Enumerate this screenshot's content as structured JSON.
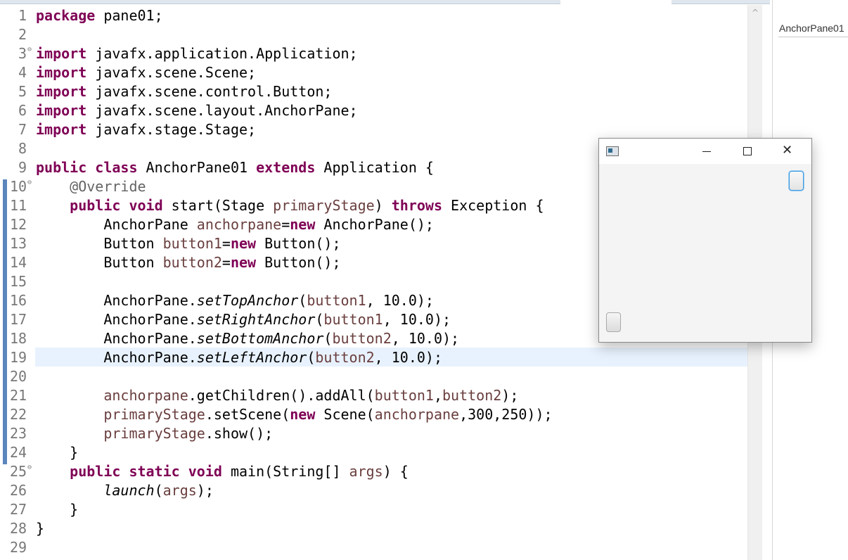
{
  "editor": {
    "lines": [
      {
        "num": "1",
        "fold": false,
        "segments": [
          {
            "t": "package",
            "c": "kw"
          },
          {
            "t": " pane01;"
          }
        ]
      },
      {
        "num": "2",
        "fold": false,
        "segments": []
      },
      {
        "num": "3",
        "fold": true,
        "segments": [
          {
            "t": "import",
            "c": "kw"
          },
          {
            "t": " javafx.application.Application;"
          }
        ]
      },
      {
        "num": "4",
        "fold": false,
        "segments": [
          {
            "t": "import",
            "c": "kw"
          },
          {
            "t": " javafx.scene.Scene;"
          }
        ]
      },
      {
        "num": "5",
        "fold": false,
        "segments": [
          {
            "t": "import",
            "c": "kw"
          },
          {
            "t": " javafx.scene.control.Button;"
          }
        ]
      },
      {
        "num": "6",
        "fold": false,
        "segments": [
          {
            "t": "import",
            "c": "kw"
          },
          {
            "t": " javafx.scene.layout.AnchorPane;"
          }
        ]
      },
      {
        "num": "7",
        "fold": false,
        "segments": [
          {
            "t": "import",
            "c": "kw"
          },
          {
            "t": " javafx.stage.Stage;"
          }
        ]
      },
      {
        "num": "8",
        "fold": false,
        "segments": []
      },
      {
        "num": "9",
        "fold": false,
        "segments": [
          {
            "t": "public class",
            "c": "kw"
          },
          {
            "t": " AnchorPane01 "
          },
          {
            "t": "extends",
            "c": "kw"
          },
          {
            "t": " Application {"
          }
        ]
      },
      {
        "num": "10",
        "fold": true,
        "segments": [
          {
            "t": "    "
          },
          {
            "t": "@Override",
            "c": "ann"
          }
        ]
      },
      {
        "num": "11",
        "fold": false,
        "segments": [
          {
            "t": "    "
          },
          {
            "t": "public void",
            "c": "kw"
          },
          {
            "t": " start(Stage "
          },
          {
            "t": "primaryStage",
            "c": "var"
          },
          {
            "t": ") "
          },
          {
            "t": "throws",
            "c": "kw"
          },
          {
            "t": " Exception {"
          }
        ]
      },
      {
        "num": "12",
        "fold": false,
        "segments": [
          {
            "t": "        AnchorPane "
          },
          {
            "t": "anchorpane",
            "c": "var"
          },
          {
            "t": "="
          },
          {
            "t": "new",
            "c": "kw"
          },
          {
            "t": " AnchorPane();"
          }
        ]
      },
      {
        "num": "13",
        "fold": false,
        "segments": [
          {
            "t": "        Button "
          },
          {
            "t": "button1",
            "c": "var"
          },
          {
            "t": "="
          },
          {
            "t": "new",
            "c": "kw"
          },
          {
            "t": " Button();"
          }
        ]
      },
      {
        "num": "14",
        "fold": false,
        "segments": [
          {
            "t": "        Button "
          },
          {
            "t": "button2",
            "c": "var"
          },
          {
            "t": "="
          },
          {
            "t": "new",
            "c": "kw"
          },
          {
            "t": " Button();"
          }
        ]
      },
      {
        "num": "15",
        "fold": false,
        "segments": []
      },
      {
        "num": "16",
        "fold": false,
        "segments": [
          {
            "t": "        AnchorPane."
          },
          {
            "t": "setTopAnchor",
            "c": "ita"
          },
          {
            "t": "("
          },
          {
            "t": "button1",
            "c": "var"
          },
          {
            "t": ", 10.0);"
          }
        ]
      },
      {
        "num": "17",
        "fold": false,
        "segments": [
          {
            "t": "        AnchorPane."
          },
          {
            "t": "setRightAnchor",
            "c": "ita"
          },
          {
            "t": "("
          },
          {
            "t": "button1",
            "c": "var"
          },
          {
            "t": ", 10.0);"
          }
        ]
      },
      {
        "num": "18",
        "fold": false,
        "segments": [
          {
            "t": "        AnchorPane."
          },
          {
            "t": "setBottomAnchor",
            "c": "ita"
          },
          {
            "t": "("
          },
          {
            "t": "button2",
            "c": "var"
          },
          {
            "t": ", 10.0);"
          }
        ]
      },
      {
        "num": "19",
        "fold": false,
        "current": true,
        "segments": [
          {
            "t": "        AnchorPane."
          },
          {
            "t": "setLeftAnchor",
            "c": "ita"
          },
          {
            "t": "("
          },
          {
            "t": "button2",
            "c": "var"
          },
          {
            "t": ", 10.0);"
          }
        ]
      },
      {
        "num": "20",
        "fold": false,
        "segments": []
      },
      {
        "num": "21",
        "fold": false,
        "segments": [
          {
            "t": "        "
          },
          {
            "t": "anchorpane",
            "c": "var"
          },
          {
            "t": ".getChildren().addAll("
          },
          {
            "t": "button1",
            "c": "var"
          },
          {
            "t": ","
          },
          {
            "t": "button2",
            "c": "var"
          },
          {
            "t": ");"
          }
        ]
      },
      {
        "num": "22",
        "fold": false,
        "segments": [
          {
            "t": "        "
          },
          {
            "t": "primaryStage",
            "c": "var"
          },
          {
            "t": ".setScene("
          },
          {
            "t": "new",
            "c": "kw"
          },
          {
            "t": " Scene("
          },
          {
            "t": "anchorpane",
            "c": "var"
          },
          {
            "t": ",300,250));"
          }
        ]
      },
      {
        "num": "23",
        "fold": false,
        "segments": [
          {
            "t": "        "
          },
          {
            "t": "primaryStage",
            "c": "var"
          },
          {
            "t": ".show();"
          }
        ]
      },
      {
        "num": "24",
        "fold": false,
        "segments": [
          {
            "t": "    }"
          }
        ]
      },
      {
        "num": "25",
        "fold": true,
        "segments": [
          {
            "t": "    "
          },
          {
            "t": "public static void",
            "c": "kw"
          },
          {
            "t": " main(String[] "
          },
          {
            "t": "args",
            "c": "var"
          },
          {
            "t": ") {"
          }
        ]
      },
      {
        "num": "26",
        "fold": false,
        "segments": [
          {
            "t": "        "
          },
          {
            "t": "launch",
            "c": "ita"
          },
          {
            "t": "("
          },
          {
            "t": "args",
            "c": "var"
          },
          {
            "t": ");"
          }
        ]
      },
      {
        "num": "27",
        "fold": false,
        "segments": [
          {
            "t": "    }"
          }
        ]
      },
      {
        "num": "28",
        "fold": false,
        "segments": [
          {
            "t": "}"
          }
        ]
      },
      {
        "num": "29",
        "fold": false,
        "segments": []
      }
    ],
    "fold_glyph": "⊖",
    "colors": {
      "keyword": "#7f0055",
      "annotation": "#646464",
      "variable": "#6a3e3e",
      "current_line": "#e8f2fe",
      "change_bar": "#5b86bd"
    }
  },
  "outline": {
    "title": "AnchorPane01"
  },
  "scrollbar": {
    "up_arrow": "^"
  },
  "fx_window": {
    "app_icon": "javafx-app-icon",
    "minimize_icon": "minimize-icon",
    "maximize_icon": "maximize-icon",
    "close_glyph": "✕",
    "buttons": [
      {
        "name": "button1",
        "anchor": "top-right",
        "focused": true
      },
      {
        "name": "button2",
        "anchor": "bottom-left",
        "focused": false
      }
    ]
  }
}
